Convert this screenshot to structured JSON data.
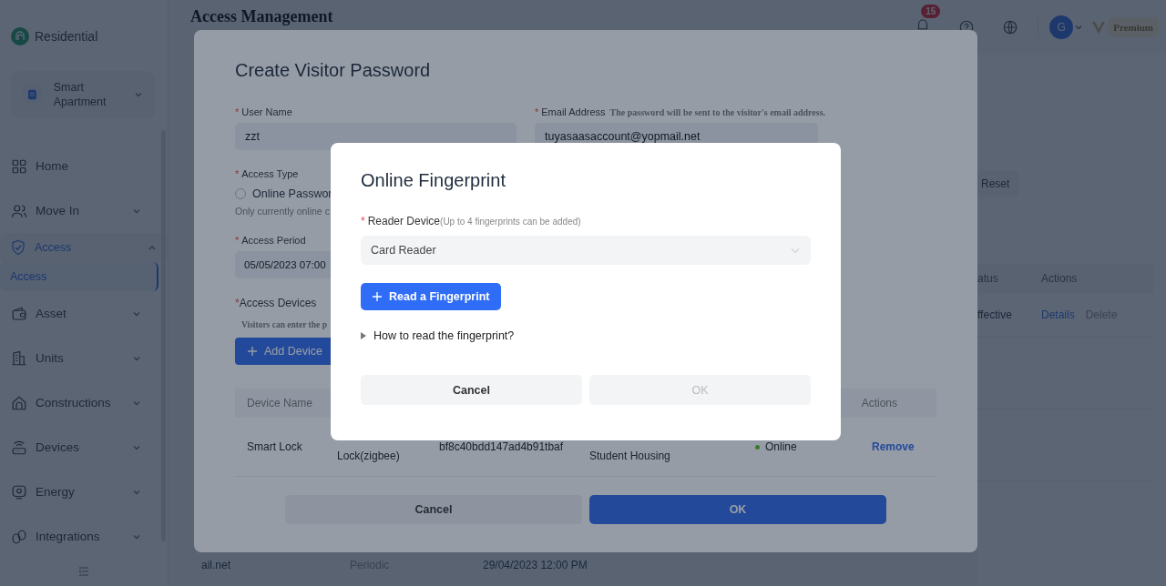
{
  "sidebar": {
    "brand": "Residential",
    "project": "Smart Apartment",
    "items": [
      {
        "label": "Home",
        "selected": false
      },
      {
        "label": "Move In",
        "selected": false,
        "expanded": false
      },
      {
        "label": "Access",
        "selected": true,
        "expanded": true,
        "children": [
          {
            "label": "Access",
            "selected": true
          }
        ]
      },
      {
        "label": "Asset",
        "selected": false,
        "expanded": false
      },
      {
        "label": "Units",
        "selected": false,
        "expanded": false
      },
      {
        "label": "Constructions",
        "selected": false,
        "expanded": false
      },
      {
        "label": "Devices",
        "selected": false,
        "expanded": false
      },
      {
        "label": "Energy",
        "selected": false,
        "expanded": false
      },
      {
        "label": "Integrations",
        "selected": false,
        "expanded": false
      }
    ]
  },
  "header": {
    "notifications": "15",
    "avatar": "G",
    "plan": "Premium"
  },
  "page": {
    "title": "Access Management",
    "reset": "Reset",
    "columns": [
      "atus",
      "Actions"
    ],
    "row": {
      "status": "ffective",
      "actions": [
        {
          "label": "Details",
          "disabled": false
        },
        {
          "label": "Delete",
          "disabled": true
        }
      ]
    },
    "bottom_row": [
      "ail.net",
      "Periodic",
      "29/04/2023 12:00 PM"
    ]
  },
  "visitor_dialog": {
    "title": "Create Visitor Password",
    "user_name": {
      "mark": "*",
      "label": "User Name",
      "value": "zzt"
    },
    "email": {
      "mark": "*",
      "label": "Email Address",
      "hint": "The password will be sent to the visitor's email address.",
      "value": "tuyasaasaccount@yopmail.net"
    },
    "access_type": {
      "mark": "*",
      "label": "Access Type",
      "option": {
        "label": "Online Passwor",
        "selected": false
      },
      "hint": "Only currently online c"
    },
    "access_period": {
      "mark": "*",
      "label": "Access Period",
      "value": "05/05/2023 07:00"
    },
    "devices": {
      "mark": "*",
      "label": "Access Devices",
      "hint": "Visitors can enter the p",
      "add_button": "Add Device",
      "columns": [
        "Device Name",
        "Actions"
      ],
      "rows": [
        {
          "cells": [
            "Smart Lock",
            "Lock(zigbee)",
            "bf8c40bdd147ad4b91tbaf",
            "Student Housing"
          ],
          "status": "Online",
          "action": "Remove"
        }
      ]
    },
    "buttons": [
      {
        "label": "Cancel",
        "kind": "default"
      },
      {
        "label": "OK",
        "kind": "primary"
      }
    ]
  },
  "fingerprint_dialog": {
    "title": "Online Fingerprint",
    "mark": "*",
    "label": "Reader Device",
    "note": "(Up to 4 fingerprints can be added)",
    "select": "Card Reader",
    "read_button": "Read a Fingerprint",
    "help": {
      "label": "How to read the fingerprint?",
      "expanded": false
    },
    "buttons": [
      {
        "label": "Cancel",
        "disabled": false
      },
      {
        "label": "OK",
        "disabled": true
      }
    ]
  }
}
